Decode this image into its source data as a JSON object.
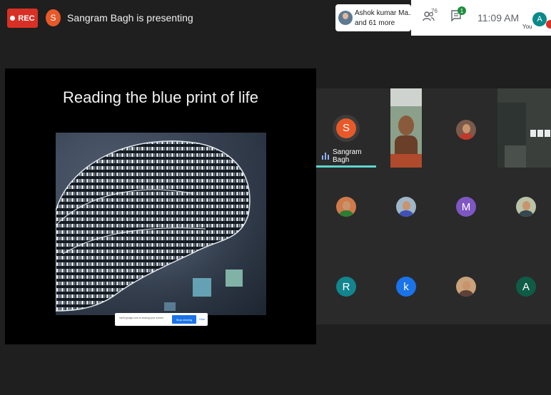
{
  "topbar": {
    "rec_label": "REC",
    "presenter_initial": "S",
    "presenting_text": "Sangram Bagh is presenting",
    "participants_chip": {
      "line1": "Ashok kumar Ma...",
      "line2": "and 61 more"
    },
    "people_count": "76",
    "chat_badge": "1",
    "time": "11:09 AM",
    "you_label": "You",
    "you_initial": "A"
  },
  "presentation": {
    "slide_title": "Reading the blue print of life",
    "share_bar": {
      "text": "meet.google.com is sharing your screen.",
      "stop_label": "Stop sharing",
      "hide_label": "Hide"
    }
  },
  "participants": {
    "presenter": {
      "initial": "S",
      "name": "Sangram Bagh",
      "color": "#e8592a"
    },
    "tiles": [
      {
        "initial": "M",
        "color": "#7e57c2"
      },
      {
        "initial": "R",
        "color": "#12858f"
      },
      {
        "initial": "k",
        "color": "#1a73e8"
      },
      {
        "initial": "A",
        "color": "#0f5b46"
      }
    ]
  },
  "colors": {
    "rec": "#d93025",
    "accent": "#1a73e8",
    "speaking": "#5dd6ce"
  }
}
